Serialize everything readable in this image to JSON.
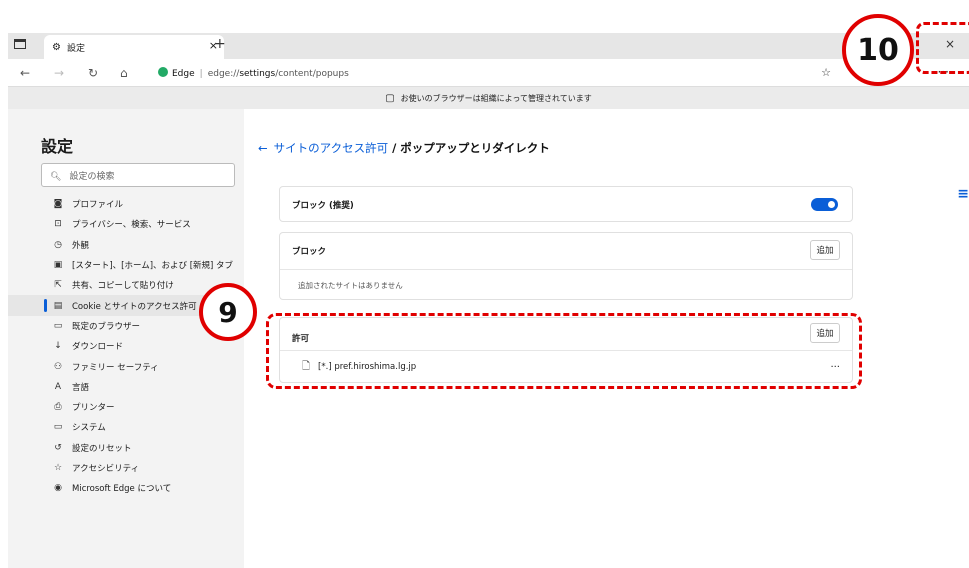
{
  "browser": {
    "tab_title": "設定",
    "tab_close": "×",
    "new_tab": "+",
    "window_close": "×",
    "url_site": "Edge",
    "url_scheme": "edge://",
    "url_bold": "settings",
    "url_rest": "/content/popups",
    "more": "···",
    "managed_notice": "お使いのブラウザーは組織によって管理されています"
  },
  "sidebar": {
    "title": "設定",
    "search_placeholder": "設定の検索",
    "items": [
      {
        "icon": "profile-icon",
        "glyph": "◙",
        "label": "プロファイル"
      },
      {
        "icon": "lock-icon",
        "glyph": "⊡",
        "label": "プライバシー、検索、サービス"
      },
      {
        "icon": "appearance-icon",
        "glyph": "◷",
        "label": "外観"
      },
      {
        "icon": "start-page-icon",
        "glyph": "▣",
        "label": "[スタート]、[ホーム]、および [新規] タブ"
      },
      {
        "icon": "share-icon",
        "glyph": "⇱",
        "label": "共有、コピーして貼り付け"
      },
      {
        "icon": "cookie-icon",
        "glyph": "▤",
        "label": "Cookie とサイトのアクセス許可",
        "active": true
      },
      {
        "icon": "default-browser-icon",
        "glyph": "▭",
        "label": "既定のブラウザー"
      },
      {
        "icon": "download-icon",
        "glyph": "↓",
        "label": "ダウンロード"
      },
      {
        "icon": "family-icon",
        "glyph": "⚇",
        "label": "ファミリー セーフティ"
      },
      {
        "icon": "language-icon",
        "glyph": "A",
        "label": "言語"
      },
      {
        "icon": "printer-icon",
        "glyph": "⎙",
        "label": "プリンター"
      },
      {
        "icon": "system-icon",
        "glyph": "▭",
        "label": "システム"
      },
      {
        "icon": "reset-icon",
        "glyph": "↺",
        "label": "設定のリセット"
      },
      {
        "icon": "accessibility-icon",
        "glyph": "☆",
        "label": "アクセシビリティ"
      },
      {
        "icon": "edge-icon",
        "glyph": "◉",
        "label": "Microsoft Edge について"
      }
    ]
  },
  "main": {
    "breadcrumb_link": "サイトのアクセス許可",
    "breadcrumb_sep": " / ",
    "breadcrumb_current": "ポップアップとリダイレクト",
    "block_recommended_label": "ブロック (推奨)",
    "block_recommended_enabled": true,
    "block_section_title": "ブロック",
    "block_add_label": "追加",
    "block_empty_text": "追加されたサイトはありません",
    "allow_section_title": "許可",
    "allow_add_label": "追加",
    "allow_sites": [
      "[*.] pref.hiroshima.lg.jp"
    ],
    "site_more": "···"
  },
  "annotations": {
    "badge_9": "9",
    "badge_10": "10",
    "accent_color": "#e00000"
  }
}
